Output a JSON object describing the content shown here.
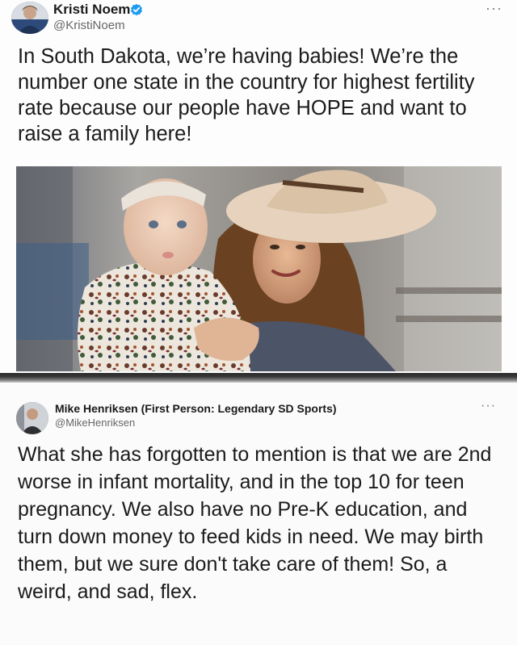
{
  "tweet1": {
    "author_name": "Kristi Noem",
    "handle": "@KristiNoem",
    "more_label": "···",
    "text": "In South Dakota, we’re having babies! We’re the number one state in the country for highest fertility rate because our people have HOPE and want to raise a family here!",
    "verified_icon": "verified-badge-icon",
    "photo_description_icon": "photo"
  },
  "tweet2": {
    "author_name": "Mike Henriksen (First Person: Legendary SD Sports)",
    "handle": "@MikeHenriksen",
    "more_label": "···",
    "text": "What she has forgotten to mention is that we are 2nd worse in infant mortality, and in the top 10 for teen pregnancy. We also have no Pre-K education, and turn down money to feed kids in need. We may birth them, but we sure don't take care of them! So, a weird, and sad, flex."
  },
  "colors": {
    "verified_blue": "#1d9bf0",
    "text": "#1b1b1b",
    "secondary_text": "#666666"
  }
}
